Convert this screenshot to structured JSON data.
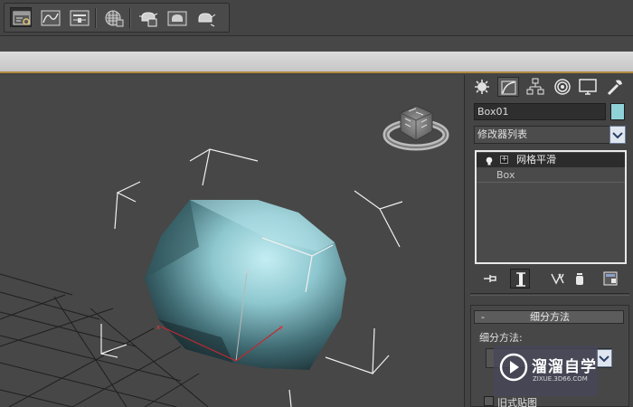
{
  "toolbar": {
    "buttons": [
      {
        "icon": "scene-explorer-icon",
        "active": true
      },
      {
        "icon": "curve-editor-icon"
      },
      {
        "icon": "render-setup-icon"
      },
      {
        "icon": "material-editor-icon"
      },
      {
        "icon": "render-frame-icon"
      },
      {
        "icon": "render-production-icon"
      },
      {
        "icon": "render-iterative-icon"
      }
    ]
  },
  "command_panel": {
    "tabs": [
      "create-tab-icon",
      "modify-tab-icon",
      "hierarchy-tab-icon",
      "motion-tab-icon",
      "display-tab-icon",
      "utilities-tab-icon"
    ],
    "active_tab": "modify-tab-icon",
    "object_name": "Box01",
    "object_color": "#8fd3d8",
    "modifier_list_label": "修改器列表",
    "stack": [
      {
        "label": "网格平滑",
        "selected": true
      },
      {
        "label": "Box",
        "selected": false
      }
    ],
    "stack_tools": [
      "pin-stack-icon",
      "show-end-result-icon",
      "make-unique-icon",
      "remove-modifier-icon",
      "configure-modifier-sets-icon"
    ],
    "rollout": {
      "toggle": "-",
      "title": "细分方法",
      "subdivision_label": "细分方法:",
      "legacy_mapping_label": "旧式贴图",
      "legacy_mapping_checked": false
    }
  },
  "viewport": {
    "object_color": "#a8dde4"
  },
  "watermark": {
    "title": "溜溜自学",
    "url": "ZIXUE.3D66.COM"
  }
}
